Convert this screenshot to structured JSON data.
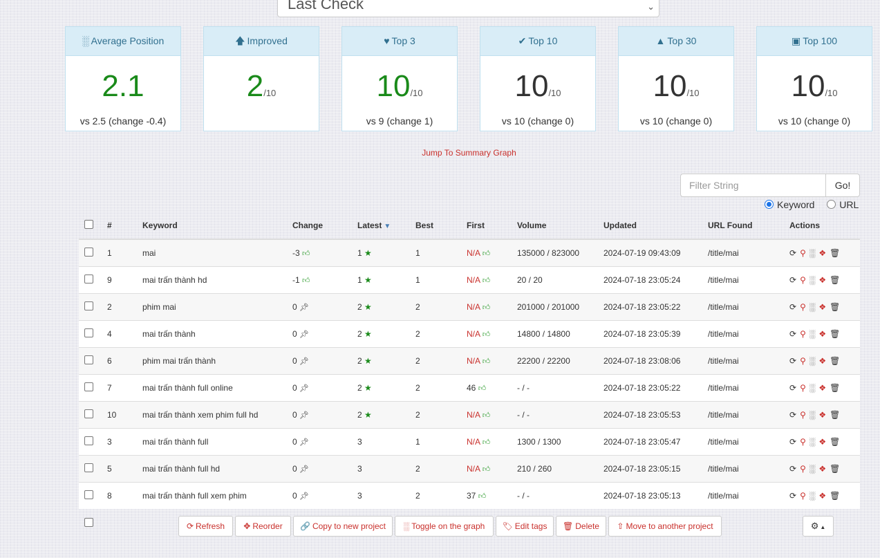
{
  "period_select": {
    "value": "Last Check"
  },
  "stats": [
    {
      "label": "Average Position",
      "icon": "bar-chart-icon",
      "value": "2.1",
      "denominator": "",
      "compare": "vs 2.5 (change -0.4)",
      "color": "#1a8a1a"
    },
    {
      "label": "Improved",
      "icon": "arrow-up-icon",
      "value": "2",
      "denominator": "/10",
      "compare": "",
      "color": "#1a8a1a"
    },
    {
      "label": "Top 3",
      "icon": "heart-icon",
      "value": "10",
      "denominator": "/10",
      "compare": "vs 9 (change 1)",
      "color": "#1a8a1a"
    },
    {
      "label": "Top 10",
      "icon": "check-icon",
      "value": "10",
      "denominator": "/10",
      "compare": "vs 10 (change 0)",
      "color": "#333333"
    },
    {
      "label": "Top 30",
      "icon": "road-icon",
      "value": "10",
      "denominator": "/10",
      "compare": "vs 10 (change 0)",
      "color": "#333333"
    },
    {
      "label": "Top 100",
      "icon": "briefcase-icon",
      "value": "10",
      "denominator": "/10",
      "compare": "vs 10 (change 0)",
      "color": "#333333"
    }
  ],
  "jump_link": "Jump To Summary Graph",
  "filter": {
    "placeholder": "Filter String",
    "go": "Go!",
    "radio_keyword": "Keyword",
    "radio_url": "URL",
    "selected": "Keyword"
  },
  "table": {
    "headers": {
      "num": "#",
      "keyword": "Keyword",
      "change": "Change",
      "latest": "Latest",
      "best": "Best",
      "first": "First",
      "volume": "Volume",
      "updated": "Updated",
      "url": "URL Found",
      "actions": "Actions"
    },
    "rows": [
      {
        "num": "1",
        "keyword": "mai",
        "change": "-3",
        "latest": "1",
        "best": "1",
        "first": "N/A",
        "volume": "135000 / 823000",
        "updated": "2024-07-19 09:43:09",
        "url": "/title/mai"
      },
      {
        "num": "9",
        "keyword": "mai trấn thành hd",
        "change": "-1",
        "latest": "1",
        "best": "1",
        "first": "N/A",
        "volume": "20 / 20",
        "updated": "2024-07-18 23:05:24",
        "url": "/title/mai"
      },
      {
        "num": "2",
        "keyword": "phim mai",
        "change": "0",
        "latest": "2",
        "best": "2",
        "first": "N/A",
        "volume": "201000 / 201000",
        "updated": "2024-07-18 23:05:22",
        "url": "/title/mai"
      },
      {
        "num": "4",
        "keyword": "mai trấn thành",
        "change": "0",
        "latest": "2",
        "best": "2",
        "first": "N/A",
        "volume": "14800 / 14800",
        "updated": "2024-07-18 23:05:39",
        "url": "/title/mai"
      },
      {
        "num": "6",
        "keyword": "phim mai trấn thành",
        "change": "0",
        "latest": "2",
        "best": "2",
        "first": "N/A",
        "volume": "22200 / 22200",
        "updated": "2024-07-18 23:08:06",
        "url": "/title/mai"
      },
      {
        "num": "7",
        "keyword": "mai trấn thành full online",
        "change": "0",
        "latest": "2",
        "best": "2",
        "first": "46",
        "volume": "- / -",
        "updated": "2024-07-18 23:05:22",
        "url": "/title/mai"
      },
      {
        "num": "10",
        "keyword": "mai trấn thành xem phim full hd",
        "change": "0",
        "latest": "2",
        "best": "2",
        "first": "N/A",
        "volume": "- / -",
        "updated": "2024-07-18 23:05:53",
        "url": "/title/mai"
      },
      {
        "num": "3",
        "keyword": "mai trấn thành full",
        "change": "0",
        "latest": "3",
        "best": "1",
        "first": "N/A",
        "volume": "1300 / 1300",
        "updated": "2024-07-18 23:05:47",
        "url": "/title/mai"
      },
      {
        "num": "5",
        "keyword": "mai trấn thành full hd",
        "change": "0",
        "latest": "3",
        "best": "2",
        "first": "N/A",
        "volume": "210 / 260",
        "updated": "2024-07-18 23:05:15",
        "url": "/title/mai"
      },
      {
        "num": "8",
        "keyword": "mai trấn thành full xem phim",
        "change": "0",
        "latest": "3",
        "best": "2",
        "first": "37",
        "volume": "- / -",
        "updated": "2024-07-18 23:05:13",
        "url": "/title/mai"
      }
    ]
  },
  "buttons": {
    "refresh": "Refresh",
    "reorder": "Reorder",
    "copy": "Copy to new project",
    "toggle_graph": "Toggle on the graph",
    "edit_tags": "Edit tags",
    "delete": "Delete",
    "move": "Move to another project"
  },
  "colors": {
    "accent": "#c9302c",
    "good": "#1a8a1a",
    "panel_head": "#d9edf7"
  }
}
